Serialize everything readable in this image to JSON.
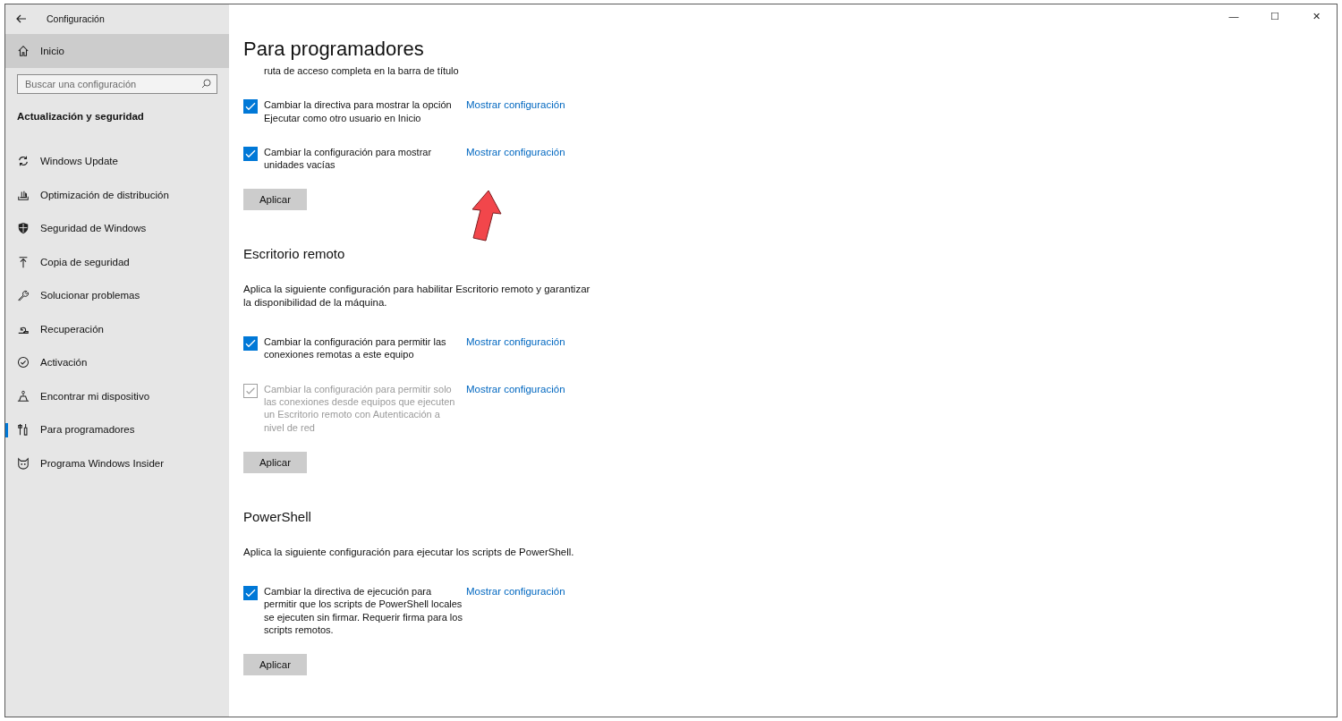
{
  "window": {
    "title": "Configuración",
    "controls": [
      "—",
      "☐",
      "✕"
    ]
  },
  "sidebar": {
    "home": {
      "label": "Inicio",
      "highlighted": true
    },
    "search": {
      "placeholder": "Buscar una configuración"
    },
    "section_title": "Actualización y seguridad",
    "items": [
      {
        "label": "Windows Update",
        "selected": false
      },
      {
        "label": "Optimización de distribución",
        "selected": false
      },
      {
        "label": "Seguridad de Windows",
        "selected": false
      },
      {
        "label": "Copia de seguridad",
        "selected": false
      },
      {
        "label": "Solucionar problemas",
        "selected": false
      },
      {
        "label": "Recuperación",
        "selected": false
      },
      {
        "label": "Activación",
        "selected": false
      },
      {
        "label": "Encontrar mi dispositivo",
        "selected": false
      },
      {
        "label": "Para programadores",
        "selected": true
      },
      {
        "label": "Programa Windows Insider",
        "selected": false
      }
    ]
  },
  "page": {
    "title": "Para programadores",
    "groups": [
      {
        "options": [
          {
            "kind": "continuation",
            "label": "ruta de acceso completa en la barra de título"
          },
          {
            "kind": "checkbox",
            "label": "Cambiar la directiva para mostrar la opción Ejecutar como otro usuario en Inicio",
            "checked": true,
            "disabled": false,
            "link": "Mostrar configuración"
          },
          {
            "kind": "checkbox",
            "label": "Cambiar la configuración para mostrar unidades vacías",
            "checked": true,
            "disabled": false,
            "link": "Mostrar configuración"
          }
        ],
        "button": "Aplicar",
        "annotated": true
      },
      {
        "heading": "Escritorio remoto",
        "description": "Aplica la siguiente configuración para habilitar Escritorio remoto y garantizar la disponibilidad de la máquina.",
        "options": [
          {
            "kind": "checkbox",
            "label": "Cambiar la configuración para permitir las conexiones remotas a este equipo",
            "checked": true,
            "disabled": false,
            "link": "Mostrar configuración"
          },
          {
            "kind": "checkbox",
            "label": "Cambiar la configuración para permitir solo las conexiones desde equipos que ejecuten un Escritorio remoto con Autenticación a nivel de red",
            "checked": true,
            "disabled": true,
            "link": "Mostrar configuración"
          }
        ],
        "button": "Aplicar",
        "annotated": false
      },
      {
        "heading": "PowerShell",
        "description": "Aplica la siguiente configuración para ejecutar los scripts de PowerShell.",
        "options": [
          {
            "kind": "checkbox",
            "label": "Cambiar la directiva de ejecución para permitir que los scripts de PowerShell locales se ejecuten sin firmar. Requerir firma para los scripts remotos.",
            "checked": true,
            "disabled": false,
            "link": "Mostrar configuración"
          }
        ],
        "button": "Aplicar",
        "annotated": false
      }
    ]
  }
}
